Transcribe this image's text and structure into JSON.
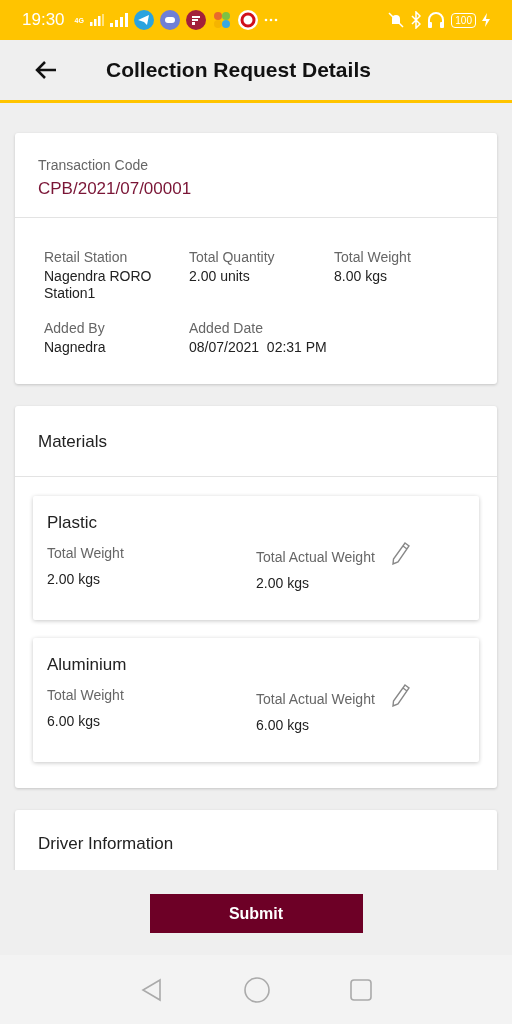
{
  "status_bar": {
    "time": "19:30",
    "network": "4G",
    "battery": "100"
  },
  "header": {
    "title": "Collection Request Details"
  },
  "transaction": {
    "label": "Transaction Code",
    "code": "CPB/2021/07/00001"
  },
  "details": [
    {
      "label": "Retail Station",
      "value": "Nagendra RORO Station1"
    },
    {
      "label": "Total Quantity",
      "value": "2.00 units"
    },
    {
      "label": "Total Weight",
      "value": "8.00 kgs"
    },
    {
      "label": "Added By",
      "value": "Nagnedra"
    },
    {
      "label": "Added Date",
      "value": "08/07/2021  02:31 PM"
    }
  ],
  "materials": {
    "title": "Materials",
    "items": [
      {
        "name": "Plastic",
        "weight_label": "Total Weight",
        "weight": "2.00 kgs",
        "actual_label": "Total Actual Weight",
        "actual": "2.00 kgs"
      },
      {
        "name": "Aluminium",
        "weight_label": "Total Weight",
        "weight": "6.00 kgs",
        "actual_label": "Total Actual Weight",
        "actual": "6.00 kgs"
      }
    ]
  },
  "driver": {
    "title": "Driver Information"
  },
  "submit": "Submit"
}
